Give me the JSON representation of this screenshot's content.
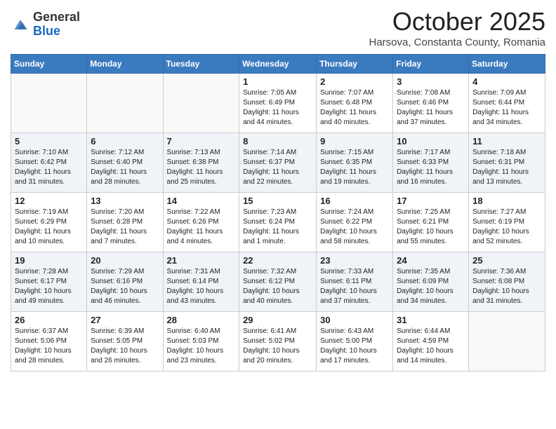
{
  "header": {
    "logo_general": "General",
    "logo_blue": "Blue",
    "month_title": "October 2025",
    "location": "Harsova, Constanta County, Romania"
  },
  "days_of_week": [
    "Sunday",
    "Monday",
    "Tuesday",
    "Wednesday",
    "Thursday",
    "Friday",
    "Saturday"
  ],
  "weeks": [
    [
      {
        "day": "",
        "info": ""
      },
      {
        "day": "",
        "info": ""
      },
      {
        "day": "",
        "info": ""
      },
      {
        "day": "1",
        "info": "Sunrise: 7:05 AM\nSunset: 6:49 PM\nDaylight: 11 hours and 44 minutes."
      },
      {
        "day": "2",
        "info": "Sunrise: 7:07 AM\nSunset: 6:48 PM\nDaylight: 11 hours and 40 minutes."
      },
      {
        "day": "3",
        "info": "Sunrise: 7:08 AM\nSunset: 6:46 PM\nDaylight: 11 hours and 37 minutes."
      },
      {
        "day": "4",
        "info": "Sunrise: 7:09 AM\nSunset: 6:44 PM\nDaylight: 11 hours and 34 minutes."
      }
    ],
    [
      {
        "day": "5",
        "info": "Sunrise: 7:10 AM\nSunset: 6:42 PM\nDaylight: 11 hours and 31 minutes."
      },
      {
        "day": "6",
        "info": "Sunrise: 7:12 AM\nSunset: 6:40 PM\nDaylight: 11 hours and 28 minutes."
      },
      {
        "day": "7",
        "info": "Sunrise: 7:13 AM\nSunset: 6:38 PM\nDaylight: 11 hours and 25 minutes."
      },
      {
        "day": "8",
        "info": "Sunrise: 7:14 AM\nSunset: 6:37 PM\nDaylight: 11 hours and 22 minutes."
      },
      {
        "day": "9",
        "info": "Sunrise: 7:15 AM\nSunset: 6:35 PM\nDaylight: 11 hours and 19 minutes."
      },
      {
        "day": "10",
        "info": "Sunrise: 7:17 AM\nSunset: 6:33 PM\nDaylight: 11 hours and 16 minutes."
      },
      {
        "day": "11",
        "info": "Sunrise: 7:18 AM\nSunset: 6:31 PM\nDaylight: 11 hours and 13 minutes."
      }
    ],
    [
      {
        "day": "12",
        "info": "Sunrise: 7:19 AM\nSunset: 6:29 PM\nDaylight: 11 hours and 10 minutes."
      },
      {
        "day": "13",
        "info": "Sunrise: 7:20 AM\nSunset: 6:28 PM\nDaylight: 11 hours and 7 minutes."
      },
      {
        "day": "14",
        "info": "Sunrise: 7:22 AM\nSunset: 6:26 PM\nDaylight: 11 hours and 4 minutes."
      },
      {
        "day": "15",
        "info": "Sunrise: 7:23 AM\nSunset: 6:24 PM\nDaylight: 11 hours and 1 minute."
      },
      {
        "day": "16",
        "info": "Sunrise: 7:24 AM\nSunset: 6:22 PM\nDaylight: 10 hours and 58 minutes."
      },
      {
        "day": "17",
        "info": "Sunrise: 7:25 AM\nSunset: 6:21 PM\nDaylight: 10 hours and 55 minutes."
      },
      {
        "day": "18",
        "info": "Sunrise: 7:27 AM\nSunset: 6:19 PM\nDaylight: 10 hours and 52 minutes."
      }
    ],
    [
      {
        "day": "19",
        "info": "Sunrise: 7:28 AM\nSunset: 6:17 PM\nDaylight: 10 hours and 49 minutes."
      },
      {
        "day": "20",
        "info": "Sunrise: 7:29 AM\nSunset: 6:16 PM\nDaylight: 10 hours and 46 minutes."
      },
      {
        "day": "21",
        "info": "Sunrise: 7:31 AM\nSunset: 6:14 PM\nDaylight: 10 hours and 43 minutes."
      },
      {
        "day": "22",
        "info": "Sunrise: 7:32 AM\nSunset: 6:12 PM\nDaylight: 10 hours and 40 minutes."
      },
      {
        "day": "23",
        "info": "Sunrise: 7:33 AM\nSunset: 6:11 PM\nDaylight: 10 hours and 37 minutes."
      },
      {
        "day": "24",
        "info": "Sunrise: 7:35 AM\nSunset: 6:09 PM\nDaylight: 10 hours and 34 minutes."
      },
      {
        "day": "25",
        "info": "Sunrise: 7:36 AM\nSunset: 6:08 PM\nDaylight: 10 hours and 31 minutes."
      }
    ],
    [
      {
        "day": "26",
        "info": "Sunrise: 6:37 AM\nSunset: 5:06 PM\nDaylight: 10 hours and 28 minutes."
      },
      {
        "day": "27",
        "info": "Sunrise: 6:39 AM\nSunset: 5:05 PM\nDaylight: 10 hours and 26 minutes."
      },
      {
        "day": "28",
        "info": "Sunrise: 6:40 AM\nSunset: 5:03 PM\nDaylight: 10 hours and 23 minutes."
      },
      {
        "day": "29",
        "info": "Sunrise: 6:41 AM\nSunset: 5:02 PM\nDaylight: 10 hours and 20 minutes."
      },
      {
        "day": "30",
        "info": "Sunrise: 6:43 AM\nSunset: 5:00 PM\nDaylight: 10 hours and 17 minutes."
      },
      {
        "day": "31",
        "info": "Sunrise: 6:44 AM\nSunset: 4:59 PM\nDaylight: 10 hours and 14 minutes."
      },
      {
        "day": "",
        "info": ""
      }
    ]
  ]
}
